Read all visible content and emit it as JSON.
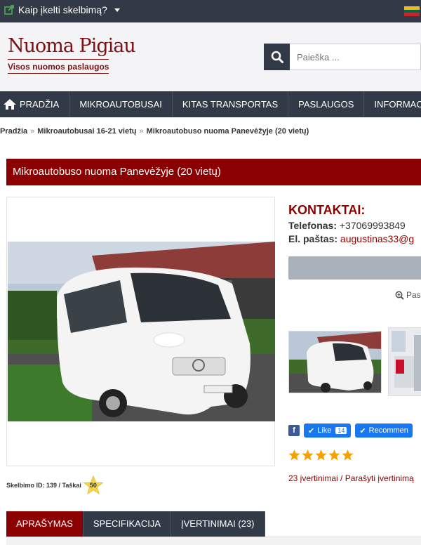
{
  "topbar": {
    "add_listing_label": "Kaip įkelti skelbimą?",
    "flag_colors": [
      "#fdb913",
      "#006a44",
      "#c1272d"
    ]
  },
  "header": {
    "logo_title": "Nuoma Pigiau",
    "logo_subtitle": "Visos nuomos paslaugos",
    "search_placeholder": "Paieška ..."
  },
  "nav": {
    "items": [
      "PRADŽIA",
      "MIKROAUTOBUSAI",
      "KITAS TRANSPORTAS",
      "PASLAUGOS",
      "INFORMACIJA"
    ]
  },
  "breadcrumb": {
    "items": [
      "Pradžia",
      "Mikroautobusai 16-21 vietų",
      "Mikroautobuso nuoma Panevėžyje (20 vietų)"
    ],
    "separator": "»"
  },
  "listing": {
    "title": "Mikroautobuso nuoma Panevėžyje (20 vietų)",
    "id_label": "Skelbimo ID: 139 / Taškai",
    "points": "50"
  },
  "contacts": {
    "heading": "KONTAKTAI:",
    "phone_label": "Telefonas:",
    "phone_value": "+37069993849",
    "email_label": "El. paštas:",
    "email_value": "augustinas33@g",
    "zoom_label": "Pas"
  },
  "social": {
    "fb_icon": "f",
    "like_label": "Like",
    "like_count": "14",
    "recommend_label": "Recommen"
  },
  "rating": {
    "stars": 5,
    "text": "23 įvertinimai / Parašyti įvertinimą"
  },
  "tabs": [
    "APRAŠYMAS",
    "SPECIFIKACIJA",
    "ĮVERTINIMAI (23)"
  ],
  "colors": {
    "brand": "#8b0000",
    "nav_bg": "#333a47",
    "star": "#f5a000"
  }
}
